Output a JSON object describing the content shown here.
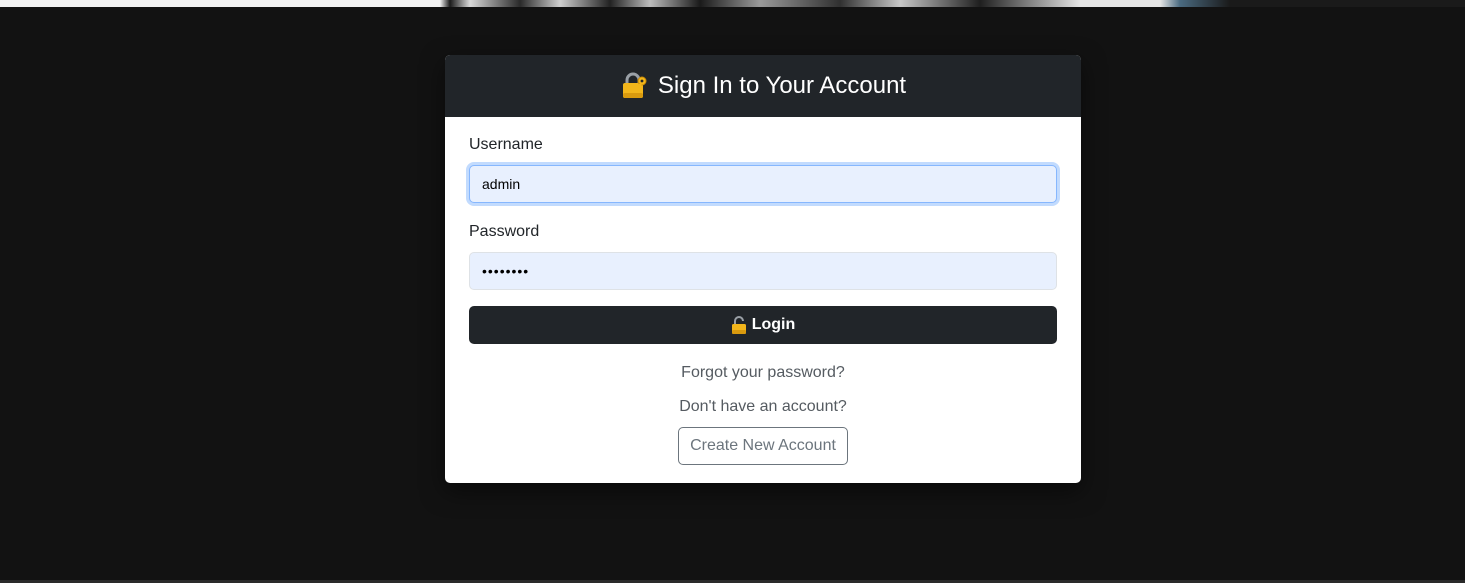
{
  "header": {
    "icon": "lock-with-key-icon",
    "title": "Sign In to Your Account"
  },
  "form": {
    "username_label": "Username",
    "username_value": "admin",
    "password_label": "Password",
    "password_value": "••••••••",
    "login_icon": "unlocked-lock-icon",
    "login_label": "Login"
  },
  "links": {
    "forgot_password": "Forgot your password?",
    "no_account_text": "Don't have an account?",
    "create_account_label": "Create New Account"
  },
  "colors": {
    "page_background": "#121212",
    "header_background": "#212529",
    "input_background": "#e8f0fe",
    "focus_ring": "#86b7fe",
    "icon_gold": "#f2b61b"
  }
}
